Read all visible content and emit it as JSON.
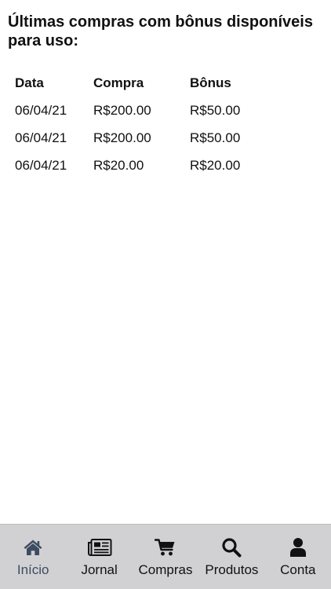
{
  "page": {
    "title": "Últimas compras com bônus disponíveis para uso:"
  },
  "table": {
    "headers": [
      "Data",
      "Compra",
      "Bônus"
    ],
    "rows": [
      [
        "06/04/21",
        "R$200.00",
        "R$50.00"
      ],
      [
        "06/04/21",
        "R$200.00",
        "R$50.00"
      ],
      [
        "06/04/21",
        "R$20.00",
        "R$20.00"
      ]
    ]
  },
  "tabbar": {
    "active_color": "#3d4c62",
    "icon_color": "#111111",
    "background": "#d1d1d3",
    "tabs": [
      {
        "label": "Início",
        "icon": "home-icon",
        "active": true
      },
      {
        "label": "Jornal",
        "icon": "newspaper-icon",
        "active": false
      },
      {
        "label": "Compras",
        "icon": "shopping-cart-icon",
        "active": false
      },
      {
        "label": "Produtos",
        "icon": "search-icon",
        "active": false
      },
      {
        "label": "Conta",
        "icon": "user-icon",
        "active": false
      }
    ]
  }
}
